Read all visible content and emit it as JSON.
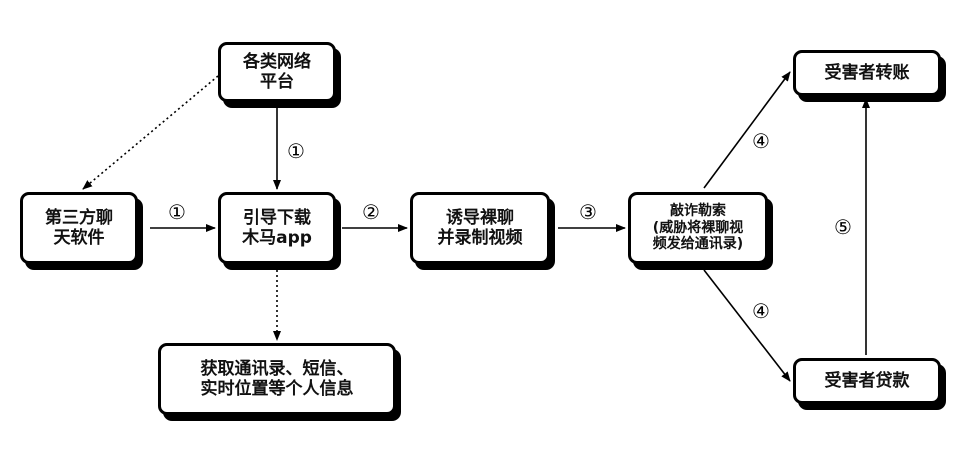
{
  "nodes": {
    "platform": "各类网络\n平台",
    "thirdparty": "第三方聊\n天软件",
    "guide": "引导下载\n木马app",
    "lure": "诱导裸聊\n并录制视频",
    "blackmail": "敲诈勒索\n(威胁将裸聊视\n频发给通讯录)",
    "transfer": "受害者转账",
    "loan": "受害者贷款",
    "info": "获取通讯录、短信、\n实时位置等个人信息"
  },
  "steps": {
    "s1_top": "①",
    "s1_left": "①",
    "s2": "②",
    "s3": "③",
    "s4_up": "④",
    "s4_down": "④",
    "s5": "⑤"
  }
}
